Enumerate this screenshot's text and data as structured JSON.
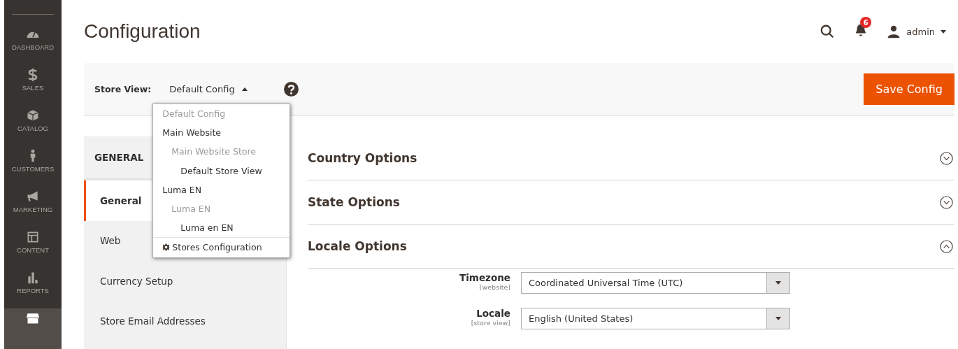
{
  "nav": [
    {
      "label": "DASHBOARD",
      "selected": false
    },
    {
      "label": "SALES",
      "selected": false
    },
    {
      "label": "CATALOG",
      "selected": false
    },
    {
      "label": "CUSTOMERS",
      "selected": false
    },
    {
      "label": "MARKETING",
      "selected": false
    },
    {
      "label": "CONTENT",
      "selected": false
    },
    {
      "label": "REPORTS",
      "selected": false
    },
    {
      "selected": true
    }
  ],
  "page_title": "Configuration",
  "header": {
    "notifications": "6",
    "user": "admin"
  },
  "scope": {
    "label": "Store View:",
    "value": "Default Config",
    "expanded": true,
    "options": [
      {
        "label": "Default Config",
        "disabled": true
      },
      {
        "label": "Main Website",
        "disabled": false,
        "children": [
          {
            "label": "Main Website Store",
            "disabled": true,
            "children": [
              {
                "label": "Default Store View",
                "disabled": false
              }
            ]
          }
        ]
      },
      {
        "label": "Luma EN",
        "disabled": false,
        "children": [
          {
            "label": "Luma EN",
            "disabled": true,
            "children": [
              {
                "label": "Luma en EN",
                "disabled": false
              }
            ]
          }
        ]
      }
    ],
    "footer_link": "Stores Configuration"
  },
  "save_button": "Save Config",
  "tabs": {
    "group": "GENERAL",
    "items": [
      {
        "label": "General",
        "selected": true
      },
      {
        "label": "Web",
        "selected": false
      },
      {
        "label": "Currency Setup",
        "selected": false
      },
      {
        "label": "Store Email Addresses",
        "selected": false
      }
    ]
  },
  "sections": [
    {
      "title": "Country Options",
      "expanded": false
    },
    {
      "title": "State Options",
      "expanded": false
    },
    {
      "title": "Locale Options",
      "expanded": true,
      "fields": [
        {
          "label": "Timezone",
          "scope": "[website]",
          "value": "Coordinated Universal Time (UTC)"
        },
        {
          "label": "Locale",
          "scope": "[store view]",
          "value": "English (United States)"
        }
      ]
    }
  ]
}
